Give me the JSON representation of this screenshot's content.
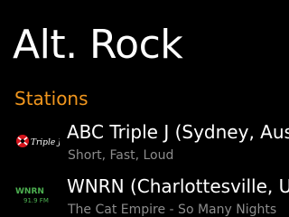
{
  "header": {
    "title": "Alt. Rock"
  },
  "section": {
    "label": "Stations",
    "accent_color": "#f0961e"
  },
  "stations": [
    {
      "name": "ABC Triple J (Sydney, Aust",
      "subtitle": "Short, Fast, Loud",
      "logo_text": "Triple J",
      "logo_icon": "triple-j-logo-icon"
    },
    {
      "name": "WNRN (Charlottesville, US",
      "subtitle": "The Cat Empire - So Many Nights",
      "logo_text_top": "WNRN",
      "logo_text_bottom": "91.9 FM",
      "logo_color": "#4caf50",
      "logo_icon": "wnrn-logo-icon"
    }
  ]
}
